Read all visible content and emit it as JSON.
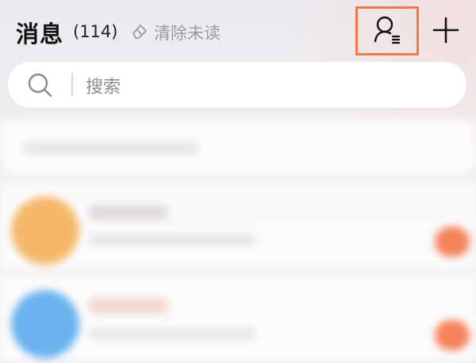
{
  "header": {
    "title": "消息",
    "count": "(114)",
    "clear_unread_label": "清除未读"
  },
  "search": {
    "placeholder": "搜索"
  },
  "icons": {
    "clear": "eraser-icon",
    "contacts": "contacts-list-icon",
    "add": "plus-icon",
    "search": "search-icon"
  },
  "colors": {
    "highlight_border": "#f07a4b",
    "avatar_1": "#f5b86a",
    "avatar_2": "#6bb3ee",
    "badge": "#f4825a"
  }
}
